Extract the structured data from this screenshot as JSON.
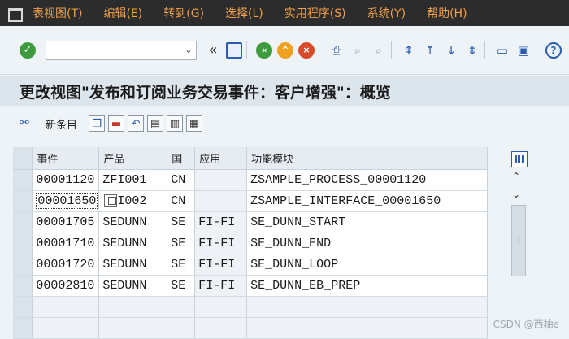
{
  "menubar": {
    "items": [
      "表视图(T)",
      "编辑(E)",
      "转到(G)",
      "选择(L)",
      "实用程序(S)",
      "系统(Y)",
      "帮助(H)"
    ]
  },
  "toolbar": {
    "command_field_value": "",
    "icons": [
      "check-icon",
      "back-arrows-icon",
      "save-icon",
      "back-icon",
      "exit-icon",
      "cancel-icon",
      "print-icon",
      "find-icon",
      "find-next-icon",
      "first-page-icon",
      "previous-page-icon",
      "next-page-icon",
      "last-page-icon",
      "create-session-icon",
      "shortcut-icon",
      "help-icon"
    ]
  },
  "title": "更改视图\"发布和订阅业务交易事件：客户增强\"：概览",
  "app_toolbar": {
    "new_entries_label": "新条目",
    "icons": [
      "display-change-icon",
      "copy-as-icon",
      "delete-icon",
      "undo-icon",
      "select-all-icon",
      "select-block-icon",
      "deselect-all-icon"
    ]
  },
  "table": {
    "columns": [
      "事件",
      "产品",
      "国",
      "应用",
      "功能模块"
    ],
    "rows": [
      {
        "event": "00001120",
        "product": "ZFI001",
        "country": "CN",
        "app": "",
        "function_module": "ZSAMPLE_PROCESS_00001120"
      },
      {
        "event": "00001650",
        "product": "I002",
        "country": "CN",
        "app": "",
        "function_module": "ZSAMPLE_INTERFACE_00001650"
      },
      {
        "event": "00001705",
        "product": "SEDUNN",
        "country": "SE",
        "app": "FI-FI",
        "function_module": "SE_DUNN_START"
      },
      {
        "event": "00001710",
        "product": "SEDUNN",
        "country": "SE",
        "app": "FI-FI",
        "function_module": "SE_DUNN_END"
      },
      {
        "event": "00001720",
        "product": "SEDUNN",
        "country": "SE",
        "app": "FI-FI",
        "function_module": "SE_DUNN_LOOP"
      },
      {
        "event": "00002810",
        "product": "SEDUNN",
        "country": "SE",
        "app": "FI-FI",
        "function_module": "SE_DUNN_EB_PREP"
      }
    ]
  },
  "watermark": "CSDN @西柚e"
}
